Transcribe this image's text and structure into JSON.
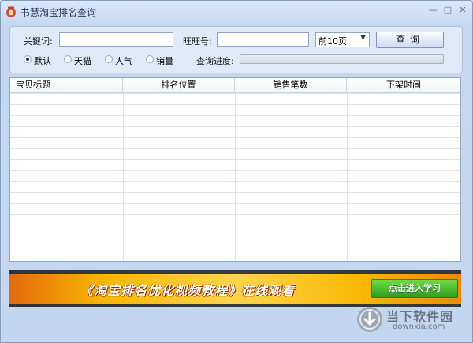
{
  "window": {
    "title": "书慧淘宝排名查询",
    "minimize": "—",
    "maximize": "□",
    "close": "✕"
  },
  "form": {
    "keyword_label": "关键词:",
    "keyword_value": "",
    "wangwang_label": "旺旺号:",
    "wangwang_value": "",
    "pages_selected": "前10页",
    "query_button": "查询",
    "progress_label": "查询进度:",
    "progress_value": 0,
    "sort_options": [
      {
        "label": "默认",
        "selected": true
      },
      {
        "label": "天猫",
        "selected": false
      },
      {
        "label": "人气",
        "selected": false
      },
      {
        "label": "销量",
        "selected": false
      }
    ]
  },
  "table": {
    "columns": [
      "宝贝标题",
      "排名位置",
      "销售笔数",
      "下架时间"
    ],
    "rows": []
  },
  "banner": {
    "text": "《淘宝排名优化视频教程》在线观看",
    "button": "点击进入学习"
  },
  "watermark": {
    "name": "当下软件园",
    "url": "downxia.com"
  }
}
